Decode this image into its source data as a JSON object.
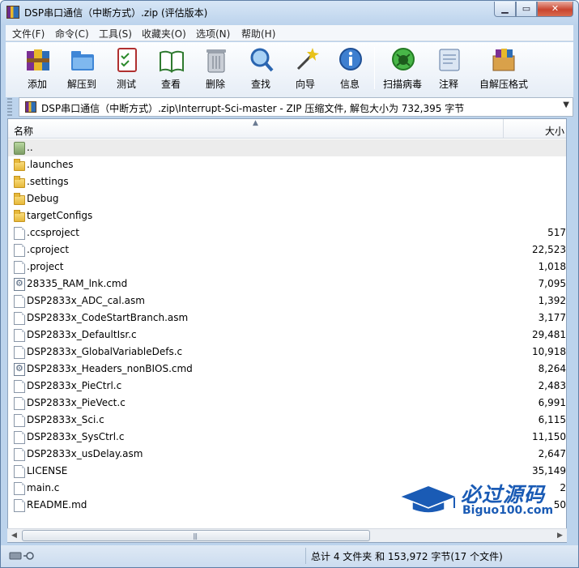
{
  "window": {
    "title": "DSP串口通信（中断方式）.zip (评估版本)"
  },
  "menu": [
    "文件(F)",
    "命令(C)",
    "工具(S)",
    "收藏夹(O)",
    "选项(N)",
    "帮助(H)"
  ],
  "toolbar": [
    {
      "label": "添加",
      "icon": "add-books-icon"
    },
    {
      "label": "解压到",
      "icon": "extract-folder-icon"
    },
    {
      "label": "测试",
      "icon": "test-checklist-icon"
    },
    {
      "label": "查看",
      "icon": "view-book-icon"
    },
    {
      "label": "删除",
      "icon": "trash-icon"
    },
    {
      "label": "查找",
      "icon": "magnifier-icon"
    },
    {
      "label": "向导",
      "icon": "wizard-wand-icon"
    },
    {
      "label": "信息",
      "icon": "info-icon"
    },
    {
      "label": "扫描病毒",
      "icon": "virus-scan-icon"
    },
    {
      "label": "注释",
      "icon": "comment-icon"
    },
    {
      "label": "自解压格式",
      "icon": "sfx-box-icon"
    }
  ],
  "path": {
    "text": "DSP串口通信（中断方式）.zip\\Interrupt-Sci-master - ZIP 压缩文件, 解包大小为 732,395 字节"
  },
  "columns": {
    "name": "名称",
    "size": "大小"
  },
  "files": [
    {
      "name": "..",
      "size": "",
      "type": "updir"
    },
    {
      "name": ".launches",
      "size": "",
      "type": "folder"
    },
    {
      "name": ".settings",
      "size": "",
      "type": "folder"
    },
    {
      "name": "Debug",
      "size": "",
      "type": "folder"
    },
    {
      "name": "targetConfigs",
      "size": "",
      "type": "folder"
    },
    {
      "name": ".ccsproject",
      "size": "517",
      "type": "doc"
    },
    {
      "name": ".cproject",
      "size": "22,523",
      "type": "doc"
    },
    {
      "name": ".project",
      "size": "1,018",
      "type": "doc"
    },
    {
      "name": "28335_RAM_lnk.cmd",
      "size": "7,095",
      "type": "cmd"
    },
    {
      "name": "DSP2833x_ADC_cal.asm",
      "size": "1,392",
      "type": "doc"
    },
    {
      "name": "DSP2833x_CodeStartBranch.asm",
      "size": "3,177",
      "type": "doc"
    },
    {
      "name": "DSP2833x_DefaultIsr.c",
      "size": "29,481",
      "type": "doc"
    },
    {
      "name": "DSP2833x_GlobalVariableDefs.c",
      "size": "10,918",
      "type": "doc"
    },
    {
      "name": "DSP2833x_Headers_nonBIOS.cmd",
      "size": "8,264",
      "type": "cmd"
    },
    {
      "name": "DSP2833x_PieCtrl.c",
      "size": "2,483",
      "type": "doc"
    },
    {
      "name": "DSP2833x_PieVect.c",
      "size": "6,991",
      "type": "doc"
    },
    {
      "name": "DSP2833x_Sci.c",
      "size": "6,115",
      "type": "doc"
    },
    {
      "name": "DSP2833x_SysCtrl.c",
      "size": "11,150",
      "type": "doc"
    },
    {
      "name": "DSP2833x_usDelay.asm",
      "size": "2,647",
      "type": "doc"
    },
    {
      "name": "LICENSE",
      "size": "35,149",
      "type": "doc"
    },
    {
      "name": "main.c",
      "size": "2",
      "type": "doc"
    },
    {
      "name": "README.md",
      "size": "50",
      "type": "doc"
    }
  ],
  "status": {
    "text": "总计 4 文件夹 和 153,972 字节(17 个文件)"
  },
  "watermark": {
    "cn": "必过源码",
    "en": "Biguo100.com"
  }
}
